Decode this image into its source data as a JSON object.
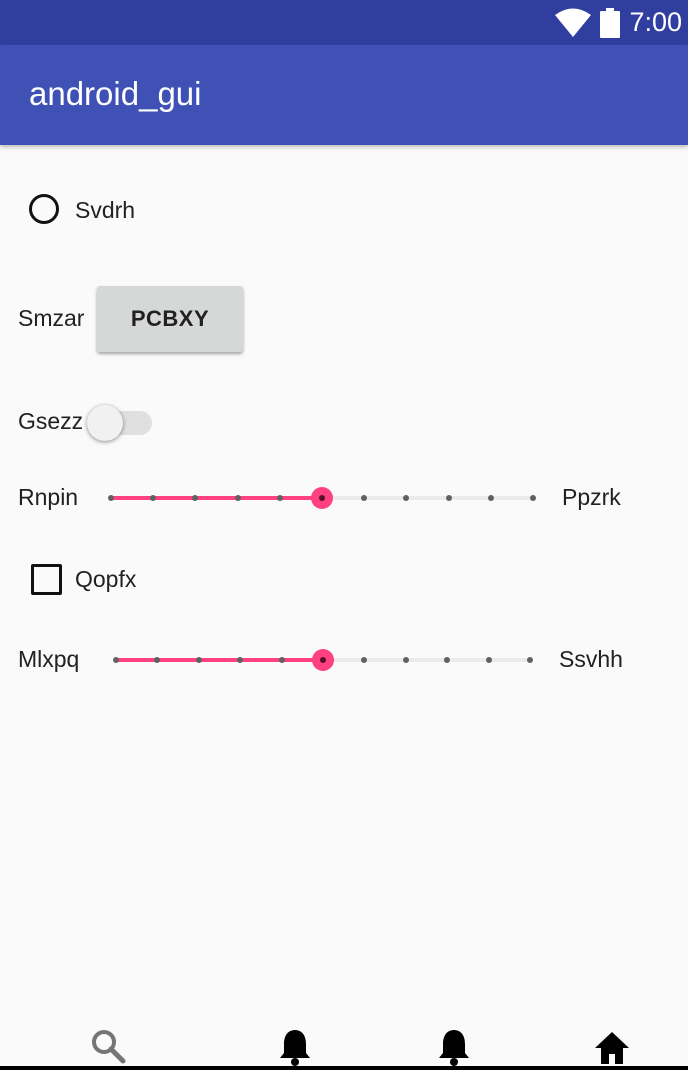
{
  "status_bar": {
    "time": "7:00",
    "icons": [
      "wifi-icon",
      "battery-icon"
    ]
  },
  "app_bar": {
    "title": "android_gui"
  },
  "radio": {
    "label": "Svdrh",
    "checked": false
  },
  "button_row": {
    "label": "Smzar",
    "button_label": "PCBXY"
  },
  "switch_row": {
    "label": "Gsezz",
    "checked": false
  },
  "slider_1": {
    "left_label": "Rnpin",
    "right_label": "Ppzrk",
    "value": 5,
    "max": 10
  },
  "checkbox": {
    "label": "Qopfx",
    "checked": false
  },
  "slider_2": {
    "left_label": "Mlxpq",
    "right_label": "Ssvhh",
    "value": 5,
    "max": 10
  },
  "bottom_nav": {
    "items": [
      "search-icon",
      "bell-icon",
      "bell-icon",
      "home-icon"
    ]
  },
  "colors": {
    "status_bar": "#303f9f",
    "app_bar": "#3f51b5",
    "accent": "#ff4081",
    "background": "#fafafa"
  }
}
